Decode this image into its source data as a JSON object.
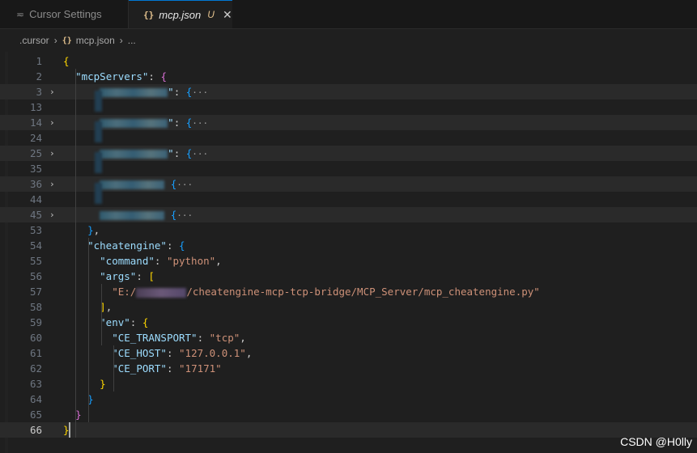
{
  "tabs": [
    {
      "label": "Cursor Settings",
      "icon": "settings-icon"
    },
    {
      "label": "mcp.json",
      "modified": "U",
      "icon": "json-icon"
    }
  ],
  "breadcrumb": {
    "folder": ".cursor",
    "file": "mcp.json",
    "more": "..."
  },
  "lines": [
    {
      "n": "1",
      "html": "<span class='b1'>{</span>"
    },
    {
      "n": "2",
      "html": "  <span class='k'>\"mcpServers\"</span><span class='p'>: </span><span class='b2'>{</span>"
    },
    {
      "n": "3",
      "fold": true,
      "stripe": true,
      "html": "      <span class='blurk' style='width:84px'></span><span class='k'>\"</span><span class='p'>: </span><span class='b3'>{</span><span class='ell'>···</span>"
    },
    {
      "n": "13",
      "html": ""
    },
    {
      "n": "14",
      "fold": true,
      "stripe": true,
      "html": "      <span class='blurk' style='width:84px'></span><span class='k'>\"</span><span class='p'>: </span><span class='b3'>{</span><span class='ell'>···</span>"
    },
    {
      "n": "24",
      "html": ""
    },
    {
      "n": "25",
      "fold": true,
      "stripe": true,
      "html": "      <span class='blurk' style='width:84px'></span><span class='k'>\"</span><span class='p'>: </span><span class='b3'>{</span><span class='ell'>···</span>"
    },
    {
      "n": "35",
      "html": ""
    },
    {
      "n": "36",
      "fold": true,
      "stripe": true,
      "html": "      <span class='blurk' style='width:80px'></span><span class='p'> </span><span class='b3'>{</span><span class='ell'>···</span>"
    },
    {
      "n": "44",
      "html": ""
    },
    {
      "n": "45",
      "fold": true,
      "stripe": true,
      "html": "      <span class='blurk' style='width:80px'></span><span class='p'> </span><span class='b3'>{</span><span class='ell'>···</span>"
    },
    {
      "n": "53",
      "html": "    <span class='b3'>}</span><span class='p'>,</span>"
    },
    {
      "n": "54",
      "html": "    <span class='k'>\"cheatengine\"</span><span class='p'>: </span><span class='b3'>{</span>"
    },
    {
      "n": "55",
      "html": "      <span class='k'>\"command\"</span><span class='p'>: </span><span class='s'>\"python\"</span><span class='p'>,</span>"
    },
    {
      "n": "56",
      "html": "      <span class='k'>\"args\"</span><span class='p'>: </span><span class='b1'>[</span>"
    },
    {
      "n": "57",
      "html": "        <span class='s'>\"E:/</span><span class='blurp'></span><span class='s'>/cheatengine-mcp-tcp-bridge/MCP_Server/mcp_cheatengine.py\"</span>"
    },
    {
      "n": "58",
      "html": "      <span class='b1'>]</span><span class='p'>,</span>"
    },
    {
      "n": "59",
      "html": "      <span class='k'>\"env\"</span><span class='p'>: </span><span class='b1'>{</span>"
    },
    {
      "n": "60",
      "html": "        <span class='k'>\"CE_TRANSPORT\"</span><span class='p'>: </span><span class='s'>\"tcp\"</span><span class='p'>,</span>"
    },
    {
      "n": "61",
      "html": "        <span class='k'>\"CE_HOST\"</span><span class='p'>: </span><span class='s'>\"127.0.0.1\"</span><span class='p'>,</span>"
    },
    {
      "n": "62",
      "html": "        <span class='k'>\"CE_PORT\"</span><span class='p'>: </span><span class='s'>\"17171\"</span>"
    },
    {
      "n": "63",
      "html": "      <span class='b1'>}</span>"
    },
    {
      "n": "64",
      "html": "    <span class='b3'>}</span>"
    },
    {
      "n": "65",
      "html": "  <span class='b2'>}</span>"
    },
    {
      "n": "66",
      "current": true,
      "html": "<span class='b1'>}</span>"
    }
  ],
  "watermark": "CSDN @H0lly"
}
